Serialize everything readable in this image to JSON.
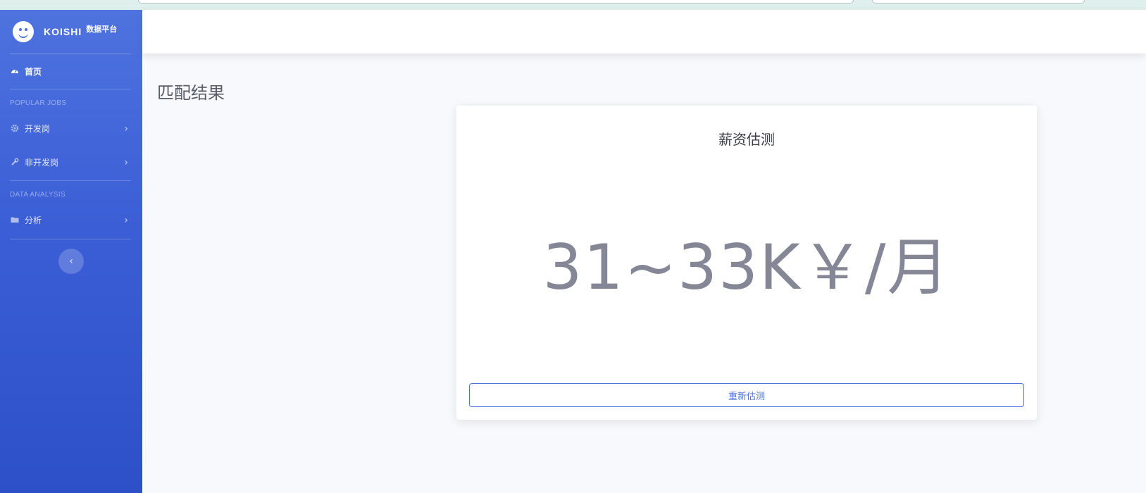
{
  "brand": {
    "name": "KOISHI",
    "subtitle": "数据平台",
    "logo_icon": "smiley-logo-icon"
  },
  "sidebar": {
    "home": {
      "label": "首页",
      "icon": "tachometer-icon"
    },
    "section_popular": "POPULAR JOBS",
    "dev_jobs": {
      "label": "开发岗",
      "icon": "gear-icon"
    },
    "nondev_jobs": {
      "label": "非开发岗",
      "icon": "wrench-icon"
    },
    "section_analysis": "DATA ANALYSIS",
    "analysis": {
      "label": "分析",
      "icon": "folder-icon"
    },
    "toggle_icon": "chevron-left-icon"
  },
  "main": {
    "page_title": "匹配结果",
    "card": {
      "title": "薪资估测",
      "salary": "31~33K￥/月",
      "button_label": "重新估测"
    }
  },
  "colors": {
    "primary": "#4e73df",
    "text_muted": "#858796",
    "background": "#f8f9fc"
  }
}
